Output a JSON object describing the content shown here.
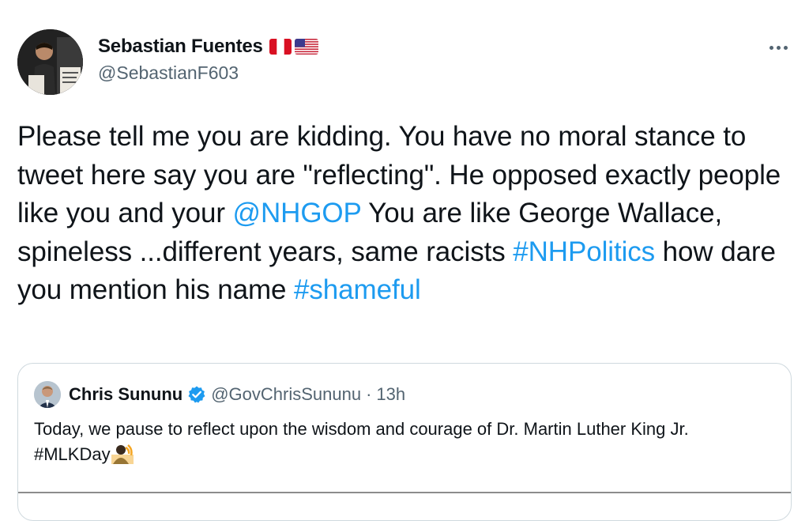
{
  "tweet": {
    "author_name": "Sebastian Fuentes",
    "author_handle": "@SebastianF603",
    "flags": [
      "peru-flag-icon",
      "usa-flag-icon"
    ],
    "text_segments": [
      {
        "type": "text",
        "value": "Please tell me you are kidding. You have no moral stance to tweet here say you are \"reflecting\". He opposed exactly people like you and your "
      },
      {
        "type": "mention",
        "value": "@NHGOP"
      },
      {
        "type": "text",
        "value": " You are like George Wallace, spineless ...different years, same racists "
      },
      {
        "type": "hashtag",
        "value": "#NHPolitics"
      },
      {
        "type": "text",
        "value": " how dare you mention his name "
      },
      {
        "type": "hashtag",
        "value": "#shameful"
      }
    ]
  },
  "quoted_tweet": {
    "author_name": "Chris Sununu",
    "verified": true,
    "author_handle": "@GovChrisSununu",
    "separator": "·",
    "time": "13h",
    "text": "Today, we pause to reflect upon the wisdom and courage of Dr. Martin Luther King Jr. #MLKDay",
    "emoji": "speaking-person-emoji"
  },
  "colors": {
    "link": "#1d9bf0",
    "secondary_text": "#536471",
    "border": "#cfd9de",
    "verified": "#1d9bf0"
  }
}
